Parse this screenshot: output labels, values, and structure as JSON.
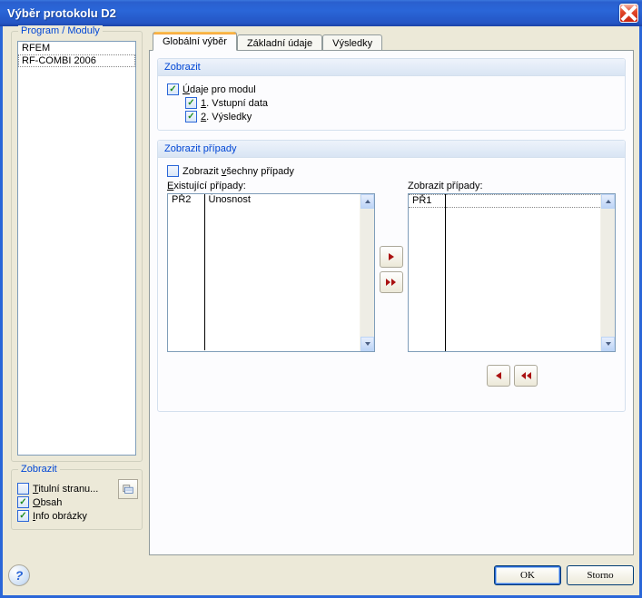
{
  "window": {
    "title": "Výběr protokolu D2"
  },
  "left": {
    "modules_legend": "Program / Moduly",
    "modules": [
      "RFEM",
      "RF-COMBI 2006"
    ],
    "zobrazit_legend": "Zobrazit",
    "titulni": {
      "char": "T",
      "rest": "itulní stranu..."
    },
    "obsah": {
      "char": "O",
      "rest": "bsah"
    },
    "info": {
      "char": "I",
      "rest": "nfo obrázky"
    }
  },
  "tabs": {
    "t1": "Globální výběr",
    "t2": "Základní údaje",
    "t3": "Výsledky"
  },
  "panel": {
    "zobrazit_hdr": "Zobrazit",
    "udaje": {
      "char": "Ú",
      "rest": "daje pro modul"
    },
    "vstupni": {
      "char": "1",
      "rest": ". Vstupní data"
    },
    "vysledky": {
      "char": "2",
      "rest": ". Výsledky"
    },
    "pripady_hdr": "Zobrazit případy",
    "vsechny": {
      "char": "v",
      "pre": "Zobrazit ",
      "rest": "šechny případy"
    },
    "existujici": {
      "char": "E",
      "rest": "xistující případy:"
    },
    "zobrazit_p": "Zobrazit případy:",
    "left_rows": [
      {
        "c0": "PŘ2",
        "c1": "Únosnost"
      }
    ],
    "right_rows": [
      {
        "c0": "PŘ1",
        "c1": ""
      }
    ]
  },
  "buttons": {
    "ok": "OK",
    "storno": "Storno"
  }
}
